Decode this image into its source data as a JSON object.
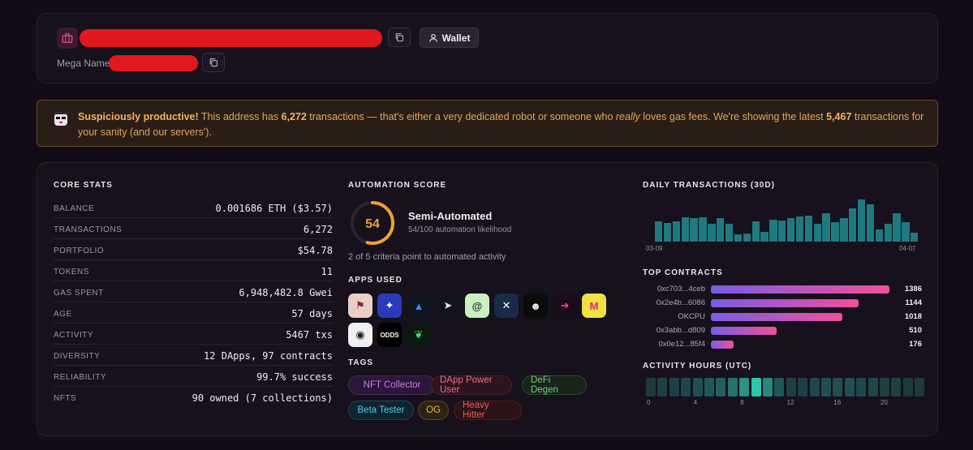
{
  "header": {
    "wallet_label": "Wallet",
    "mega_name_label": "Mega Name"
  },
  "banner": {
    "lead": "Suspiciously productive!",
    "t1": " This address has ",
    "tx_count": "6,272",
    "t2": " transactions — that's either a very dedicated robot or someone who ",
    "emph": "really",
    "t3": " loves gas fees. We're showing the latest ",
    "shown_count": "5,467",
    "t4": " transactions for your sanity (and our servers')."
  },
  "core_stats": {
    "title": "CORE STATS",
    "rows": [
      {
        "label": "BALANCE",
        "value": "0.001686 ETH ($3.57)"
      },
      {
        "label": "TRANSACTIONS",
        "value": "6,272"
      },
      {
        "label": "PORTFOLIO",
        "value": "$54.78"
      },
      {
        "label": "TOKENS",
        "value": "11"
      },
      {
        "label": "GAS SPENT",
        "value": "6,948,482.8 Gwei"
      },
      {
        "label": "AGE",
        "value": "57 days"
      },
      {
        "label": "ACTIVITY",
        "value": "5467 txs"
      },
      {
        "label": "DIVERSITY",
        "value": "12 DApps, 97 contracts"
      },
      {
        "label": "RELIABILITY",
        "value": "99.7% success"
      },
      {
        "label": "NFTS",
        "value": "90 owned (7 collections)"
      }
    ]
  },
  "automation": {
    "title": "AUTOMATION SCORE",
    "score": "54",
    "score_fraction": 0.54,
    "label": "Semi-Automated",
    "likelihood": "54/100 automation likelihood",
    "criteria": "2 of 5 criteria point to automated activity"
  },
  "apps": {
    "title": "APPS USED",
    "items": [
      {
        "icon": "flag-app-icon",
        "glyph": "⚑",
        "bg": "#e8d0c8",
        "fg": "#8a2a2a"
      },
      {
        "icon": "blue-bird-app-icon",
        "glyph": "✦",
        "bg": "#2a3ab8",
        "fg": "#ffffff"
      },
      {
        "icon": "triangle-app-icon",
        "glyph": "▲",
        "bg": "#0e1420",
        "fg": "#3a8cff"
      },
      {
        "icon": "paper-plane-app-icon",
        "glyph": "➤",
        "bg": "#101418",
        "fg": "#e8e8e8"
      },
      {
        "icon": "at-sign-app-icon",
        "glyph": "@",
        "bg": "#c8f0c0",
        "fg": "#1a3a1a"
      },
      {
        "icon": "x-circle-app-icon",
        "glyph": "✕",
        "bg": "#1a2a48",
        "fg": "#ffffff"
      },
      {
        "icon": "mascot-app-icon",
        "glyph": "☻",
        "bg": "#0a0a0a",
        "fg": "#f0f0f0"
      },
      {
        "icon": "pink-arrow-app-icon",
        "glyph": "➜",
        "bg": "#1a0c18",
        "fg": "#ff3aa8"
      },
      {
        "icon": "m-letter-app-icon",
        "glyph": "M",
        "bg": "#f0e040",
        "fg": "#e0208a"
      },
      {
        "icon": "chat-bubble-app-icon",
        "glyph": "◉",
        "bg": "#f0f0f0",
        "fg": "#202020"
      },
      {
        "icon": "odds-app-icon",
        "glyph": "ODDS",
        "bg": "#000000",
        "fg": "#ffffff"
      },
      {
        "icon": "green-leaf-app-icon",
        "glyph": "❦",
        "bg": "#0a1a10",
        "fg": "#3ae070"
      }
    ]
  },
  "tags": {
    "title": "TAGS",
    "items": [
      {
        "label": "NFT Collector",
        "color": "#c87ae8",
        "bg": "#2a1838",
        "border": "#4a2a5a"
      },
      {
        "label": "DApp Power User",
        "color": "#f06a8a",
        "bg": "#2c1420",
        "border": "#4a2030"
      },
      {
        "label": "DeFi Degen",
        "color": "#7ac87a",
        "bg": "#16241a",
        "border": "#2a4a2c"
      },
      {
        "label": "Beta Tester",
        "color": "#4ad0e8",
        "bg": "#102430",
        "border": "#1c4858"
      },
      {
        "label": "OG",
        "color": "#e8b84a",
        "bg": "#2c2214",
        "border": "#5a4420"
      },
      {
        "label": "Heavy Hitter",
        "color": "#e85a5a",
        "bg": "#2c1416",
        "border": "#4a2024"
      }
    ]
  },
  "daily": {
    "title": "DAILY TRANSACTIONS (30D)",
    "start_label": "03-09",
    "end_label": "04-07",
    "values": [
      48,
      45,
      48,
      58,
      55,
      58,
      42,
      55,
      42,
      18,
      20,
      48,
      24,
      52,
      50,
      55,
      60,
      62,
      42,
      68,
      46,
      55,
      78,
      100,
      88,
      28,
      42,
      68,
      46,
      22
    ],
    "color": "#1f7a80"
  },
  "contracts": {
    "title": "TOP CONTRACTS",
    "max": 1386,
    "items": [
      {
        "addr": "0xc703...4ceb",
        "value": 1386,
        "value_label": "1386"
      },
      {
        "addr": "0x2e4b...6086",
        "value": 1144,
        "value_label": "1144"
      },
      {
        "addr": "OKCPU",
        "value": 1018,
        "value_label": "1018"
      },
      {
        "addr": "0x3abb...d809",
        "value": 510,
        "value_label": "510"
      },
      {
        "addr": "0x0e12...85f4",
        "value": 176,
        "value_label": "176"
      }
    ]
  },
  "hours": {
    "title": "ACTIVITY HOURS (UTC)",
    "tick_labels": [
      "0",
      "4",
      "8",
      "12",
      "16",
      "20"
    ],
    "intensity": [
      0.25,
      0.3,
      0.3,
      0.35,
      0.4,
      0.45,
      0.5,
      0.6,
      0.75,
      0.95,
      0.7,
      0.45,
      0.3,
      0.3,
      0.35,
      0.4,
      0.4,
      0.4,
      0.35,
      0.35,
      0.3,
      0.3,
      0.25,
      0.25
    ]
  }
}
